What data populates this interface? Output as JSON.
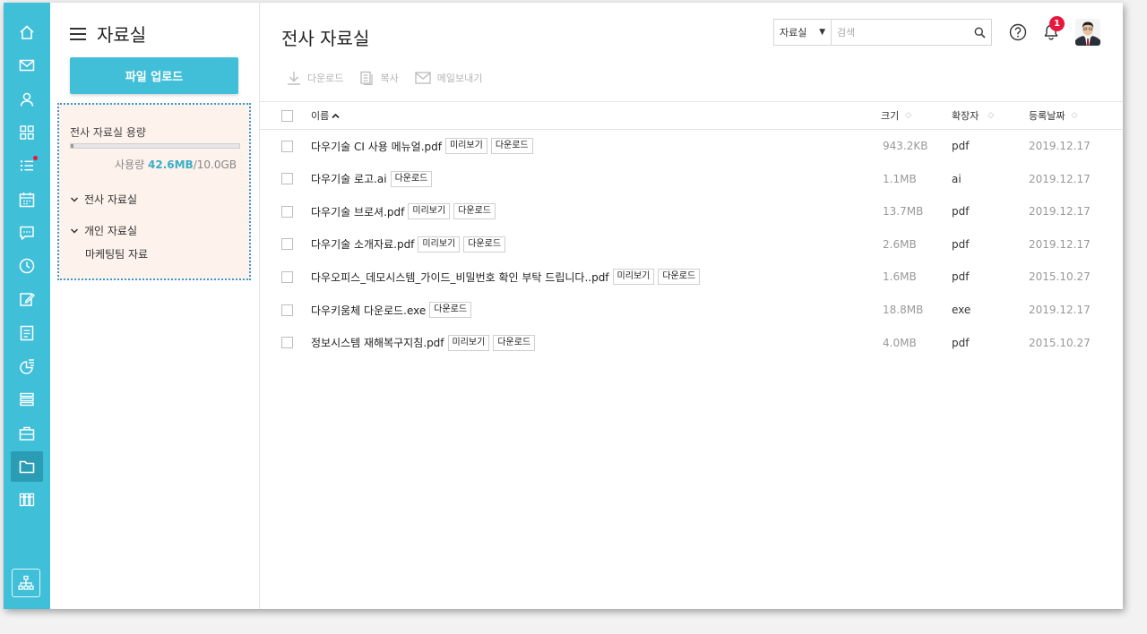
{
  "rail": {
    "items": [
      {
        "icon": "home-icon"
      },
      {
        "icon": "mail-icon"
      },
      {
        "icon": "contacts-icon"
      },
      {
        "icon": "apps-grid-icon"
      },
      {
        "icon": "task-list-icon",
        "dot": true
      },
      {
        "icon": "calendar-icon"
      },
      {
        "icon": "chat-icon"
      },
      {
        "icon": "clock-icon"
      },
      {
        "icon": "edit-icon"
      },
      {
        "icon": "report-icon"
      },
      {
        "icon": "survey-icon"
      },
      {
        "icon": "board-icon"
      },
      {
        "icon": "briefcase-icon"
      },
      {
        "icon": "folder-icon",
        "active": true
      },
      {
        "icon": "columns-icon"
      }
    ],
    "bottom_icon": "org-chart-icon"
  },
  "sidebar": {
    "title": "자료실",
    "upload_label": "파일 업로드",
    "quota": {
      "label": "전사 자료실 용량",
      "usage_prefix": "사용량",
      "used": "42.6MB",
      "total": "/10.0GB",
      "fraction": 0.004
    },
    "tree": [
      {
        "label": "전사 자료실",
        "children": []
      },
      {
        "label": "개인 자료실",
        "children": [
          {
            "label": "마케팅팀 자료"
          }
        ]
      }
    ]
  },
  "header": {
    "title": "전사 자료실",
    "search": {
      "scope": "자료실",
      "placeholder": "검색"
    },
    "notification_count": "1"
  },
  "toolbar": {
    "download_label": "다운로드",
    "copy_label": "복사",
    "mail_label": "메일보내기"
  },
  "table": {
    "columns": {
      "name": "이름",
      "size": "크기",
      "ext": "확장자",
      "date": "등록날짜"
    },
    "preview_label": "미리보기",
    "download_label": "다운로드",
    "rows": [
      {
        "name": "다우기술 CI 사용 메뉴얼.pdf",
        "preview": true,
        "size": "943.2KB",
        "ext": "pdf",
        "date": "2019.12.17"
      },
      {
        "name": "다우기술 로고.ai",
        "preview": false,
        "size": "1.1MB",
        "ext": "ai",
        "date": "2019.12.17"
      },
      {
        "name": "다우기술 브로셔.pdf",
        "preview": true,
        "size": "13.7MB",
        "ext": "pdf",
        "date": "2019.12.17"
      },
      {
        "name": "다우기술 소개자료.pdf",
        "preview": true,
        "size": "2.6MB",
        "ext": "pdf",
        "date": "2019.12.17"
      },
      {
        "name": "다우오피스_데모시스템_가이드_비밀번호 확인 부탁 드립니다..pdf",
        "preview": true,
        "size": "1.6MB",
        "ext": "pdf",
        "date": "2015.10.27"
      },
      {
        "name": "다우키움체 다운로드.exe",
        "preview": false,
        "size": "18.8MB",
        "ext": "exe",
        "date": "2019.12.17"
      },
      {
        "name": "정보시스템 재해복구지침.pdf",
        "preview": true,
        "size": "4.0MB",
        "ext": "pdf",
        "date": "2015.10.27"
      }
    ]
  },
  "colors": {
    "rail": "#3fbfd8",
    "rail_active": "#2a9db4",
    "accent": "#42bfd8",
    "quota_bg": "#fdf2ec",
    "badge": "#e8173d"
  }
}
